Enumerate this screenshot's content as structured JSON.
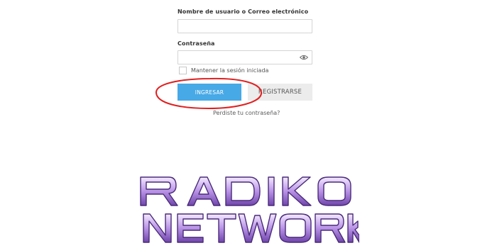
{
  "form": {
    "username_label": "Nombre de usuario o Correo electrónico",
    "username_value": "",
    "password_label": "Contraseña",
    "password_value": "",
    "remember_label": "Mantener la sesión iniciada",
    "remember_checked": false,
    "login_button": "INGRESAR",
    "register_button": "REGISTRARSE",
    "forgot_link": "Perdiste tu contraseña?"
  },
  "annotation": {
    "color": "#e02020"
  },
  "logo": {
    "line1": "RADIKO",
    "line2": "NETWORK",
    "fill_top": "#e9d6ff",
    "fill_bottom": "#7a4fb8",
    "stroke": "#4a2a7a"
  },
  "colors": {
    "primary_button": "#47a9e6",
    "secondary_button": "#ececec"
  },
  "icons": {
    "password_toggle": "eye-icon"
  }
}
